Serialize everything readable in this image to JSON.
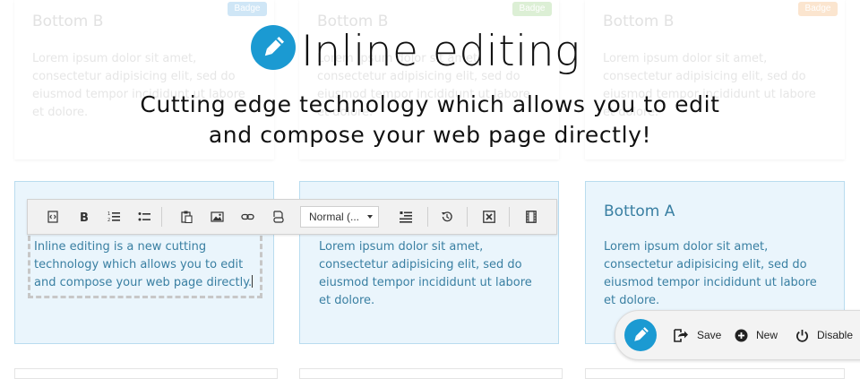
{
  "background_cards": [
    {
      "title": "Bottom B",
      "badge": "Badge",
      "badge_color": "#cfe6f6",
      "body": "Lorem ipsum dolor sit amet, consectetur adipisicing elit, sed do eiusmod tempor incididunt ut labore et dolore."
    },
    {
      "title": "Bottom B",
      "badge": "Badge",
      "badge_color": "#dcefd5",
      "body": "Lorem ipsum dolor sit amet, consectetur adipisicing elit, sed do eiusmod tempor incididunt ut labore et dolore."
    },
    {
      "title": "Bottom B",
      "badge": "Badge",
      "badge_color": "#fbe5cf",
      "body": "Lorem ipsum dolor sit amet, consectetur adipisicing elit, sed do eiusmod tempor incididunt ut labore et dolore."
    }
  ],
  "hero": {
    "title": "Inline editing",
    "subtitle_line1": "Cutting edge technology which allows you to edit",
    "subtitle_line2": "and compose your web page directly!",
    "logo_icon": "pencil-icon",
    "accent": "#1b9ad2"
  },
  "boxes": [
    {
      "text": "Inline editing is a new cutting technology which allows you to edit and compose your web page directly."
    },
    {
      "text": "Lorem ipsum dolor sit amet, consectetur adipisicing elit, sed do eiusmod tempor incididunt ut labore et dolore."
    },
    {
      "title": "Bottom A",
      "text": "Lorem ipsum dolor sit amet, consectetur adipisicing elit, sed do eiusmod tempor incididunt ut labore et dolore."
    }
  ],
  "toolbar": {
    "buttons": [
      "source-icon",
      "bold-icon",
      "numbered-list-icon",
      "bulleted-list-icon",
      "paste-icon",
      "image-icon",
      "link-icon",
      "unlink-icon",
      "format-icon",
      "history-icon",
      "remove-format-icon",
      "media-icon"
    ],
    "format_select": "Normal (..."
  },
  "floating_bar": {
    "save": "Save",
    "new": "New",
    "disable": "Disable"
  },
  "colors": {
    "box_bg": "#eaf5fc",
    "box_border": "#b9dcef",
    "box_text": "#397fa2"
  }
}
